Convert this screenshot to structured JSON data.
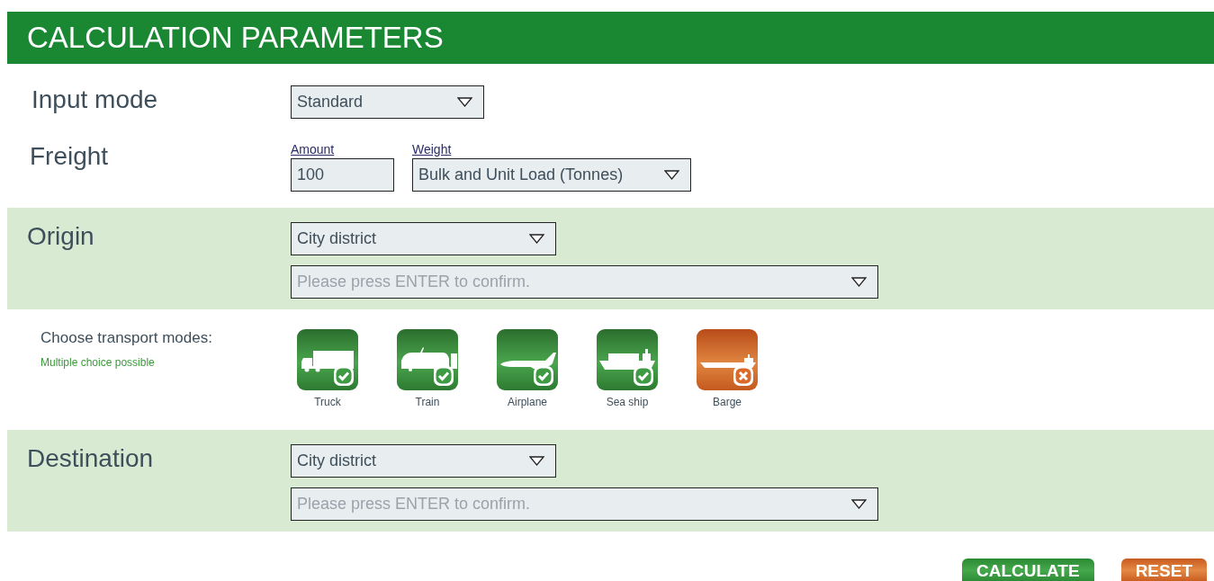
{
  "header": {
    "title": "CALCULATION PARAMETERS"
  },
  "input_mode": {
    "label": "Input mode",
    "value": "Standard"
  },
  "freight": {
    "label": "Freight",
    "amount_label": "Amount",
    "amount": "100",
    "weight_label": "Weight",
    "weight": "Bulk and Unit Load (Tonnes)"
  },
  "origin": {
    "label": "Origin",
    "area": "City district",
    "placeholder": "Please press ENTER to confirm."
  },
  "transport": {
    "title": "Choose transport modes:",
    "hint": "Multiple choice possible",
    "modes": [
      {
        "kind": "truck",
        "label": "Truck",
        "selected": true
      },
      {
        "kind": "train",
        "label": "Train",
        "selected": true
      },
      {
        "kind": "airplane",
        "label": "Airplane",
        "selected": true
      },
      {
        "kind": "ship",
        "label": "Sea ship",
        "selected": true
      },
      {
        "kind": "barge",
        "label": "Barge",
        "selected": false
      }
    ]
  },
  "destination": {
    "label": "Destination",
    "area": "City district",
    "placeholder": "Please press ENTER to confirm."
  },
  "buttons": [
    {
      "kind": "calculate",
      "label": "CALCULATE"
    },
    {
      "kind": "reset",
      "label": "RESET"
    }
  ]
}
